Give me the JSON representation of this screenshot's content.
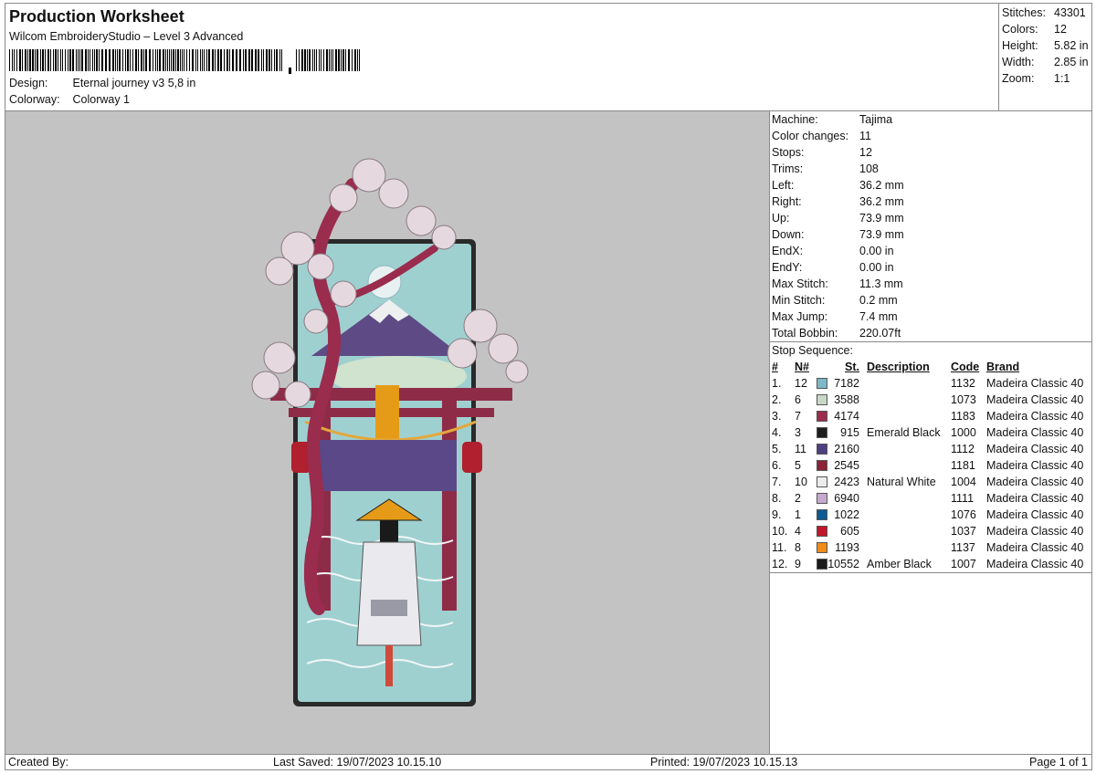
{
  "header": {
    "title": "Production Worksheet",
    "subtitle": "Wilcom EmbroideryStudio – Level 3 Advanced",
    "design_label": "Design:",
    "design_value": "Eternal journey v3 5,8 in",
    "colorway_label": "Colorway:",
    "colorway_value": "Colorway 1"
  },
  "stats": [
    {
      "label": "Stitches:",
      "value": "43301"
    },
    {
      "label": "Colors:",
      "value": "12"
    },
    {
      "label": "Height:",
      "value": "5.82 in"
    },
    {
      "label": "Width:",
      "value": "2.85 in"
    },
    {
      "label": "Zoom:",
      "value": "1:1"
    }
  ],
  "machine_info": [
    {
      "label": "Machine:",
      "value": "Tajima"
    },
    {
      "label": "Color changes:",
      "value": "11"
    },
    {
      "label": "Stops:",
      "value": "12"
    },
    {
      "label": "Trims:",
      "value": "108"
    },
    {
      "label": "Left:",
      "value": "36.2 mm"
    },
    {
      "label": "Right:",
      "value": "36.2 mm"
    },
    {
      "label": "Up:",
      "value": "73.9 mm"
    },
    {
      "label": "Down:",
      "value": "73.9 mm"
    },
    {
      "label": "EndX:",
      "value": "0.00 in"
    },
    {
      "label": "EndY:",
      "value": "0.00 in"
    },
    {
      "label": "Max Stitch:",
      "value": "11.3 mm"
    },
    {
      "label": "Min Stitch:",
      "value": "0.2 mm"
    },
    {
      "label": "Max Jump:",
      "value": "7.4 mm"
    },
    {
      "label": "Total Bobbin:",
      "value": "220.07ft"
    }
  ],
  "stop_sequence": {
    "label": "Stop Sequence:",
    "headers": {
      "idx": "#",
      "n": "N#",
      "st": "St.",
      "desc": "Description",
      "code": "Code",
      "brand": "Brand"
    },
    "rows": [
      {
        "idx": "1.",
        "n": "12",
        "color": "#7fb8c8",
        "st": "7182",
        "desc": "",
        "code": "1132",
        "brand": "Madeira Classic 40"
      },
      {
        "idx": "2.",
        "n": "6",
        "color": "#c8d8c8",
        "st": "3588",
        "desc": "",
        "code": "1073",
        "brand": "Madeira Classic 40"
      },
      {
        "idx": "3.",
        "n": "7",
        "color": "#9a2c4e",
        "st": "4174",
        "desc": "",
        "code": "1183",
        "brand": "Madeira Classic 40"
      },
      {
        "idx": "4.",
        "n": "3",
        "color": "#1e1e1e",
        "st": "915",
        "desc": "Emerald Black",
        "code": "1000",
        "brand": "Madeira Classic 40"
      },
      {
        "idx": "5.",
        "n": "11",
        "color": "#4e3f80",
        "st": "2160",
        "desc": "",
        "code": "1112",
        "brand": "Madeira Classic 40"
      },
      {
        "idx": "6.",
        "n": "5",
        "color": "#8b2238",
        "st": "2545",
        "desc": "",
        "code": "1181",
        "brand": "Madeira Classic 40"
      },
      {
        "idx": "7.",
        "n": "10",
        "color": "#ececec",
        "st": "2423",
        "desc": "Natural White",
        "code": "1004",
        "brand": "Madeira Classic 40"
      },
      {
        "idx": "8.",
        "n": "2",
        "color": "#c7a8cf",
        "st": "6940",
        "desc": "",
        "code": "1111",
        "brand": "Madeira Classic 40"
      },
      {
        "idx": "9.",
        "n": "1",
        "color": "#0d5b94",
        "st": "1022",
        "desc": "",
        "code": "1076",
        "brand": "Madeira Classic 40"
      },
      {
        "idx": "10.",
        "n": "4",
        "color": "#c0182a",
        "st": "605",
        "desc": "",
        "code": "1037",
        "brand": "Madeira Classic 40"
      },
      {
        "idx": "11.",
        "n": "8",
        "color": "#f08c18",
        "st": "1193",
        "desc": "",
        "code": "1137",
        "brand": "Madeira Classic 40"
      },
      {
        "idx": "12.",
        "n": "9",
        "color": "#1a1a1a",
        "st": "10552",
        "desc": "Amber Black",
        "code": "1007",
        "brand": "Madeira Classic 40"
      }
    ]
  },
  "footer": {
    "created": "Created By:",
    "saved": "Last Saved: 19/07/2023 10.15.10",
    "printed": "Printed: 19/07/2023 10.15.13",
    "page": "Page 1 of 1"
  },
  "colors": {
    "preview_bg": "#c3c3c3",
    "border": "#8a8a8a"
  },
  "icons": {
    "barcode": "barcode-graphic",
    "design_preview": "embroidery-design-preview"
  }
}
